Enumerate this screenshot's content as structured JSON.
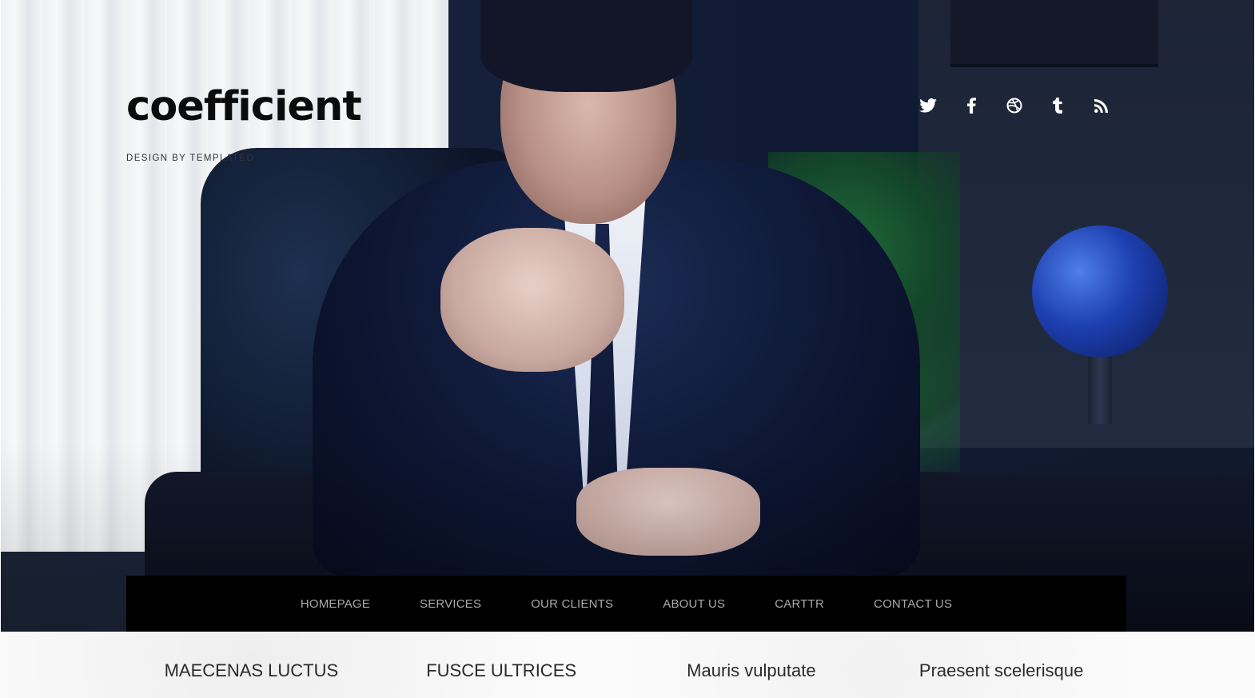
{
  "site": {
    "title": "coefficient",
    "tagline": "DESIGN BY TEMPLATED"
  },
  "social": [
    {
      "name": "twitter",
      "icon": "twitter-icon"
    },
    {
      "name": "facebook",
      "icon": "facebook-icon"
    },
    {
      "name": "dribbble",
      "icon": "dribbble-icon"
    },
    {
      "name": "tumblr",
      "icon": "tumblr-icon"
    },
    {
      "name": "rss",
      "icon": "rss-icon"
    }
  ],
  "nav": {
    "items": [
      "HOMEPAGE",
      "SERVICES",
      "OUR CLIENTS",
      "ABOUT US",
      "CARTTR",
      "CONTACT US"
    ]
  },
  "columns": {
    "headings": [
      "MAECENAS LUCTUS",
      "FUSCE ULTRICES",
      "Mauris vulputate",
      "Praesent scelerisque"
    ]
  },
  "colors": {
    "nav_background": "#000000",
    "nav_text": "#a9a9a9",
    "logo_text": "#0b0b0b",
    "icon_color": "#ffffff"
  }
}
